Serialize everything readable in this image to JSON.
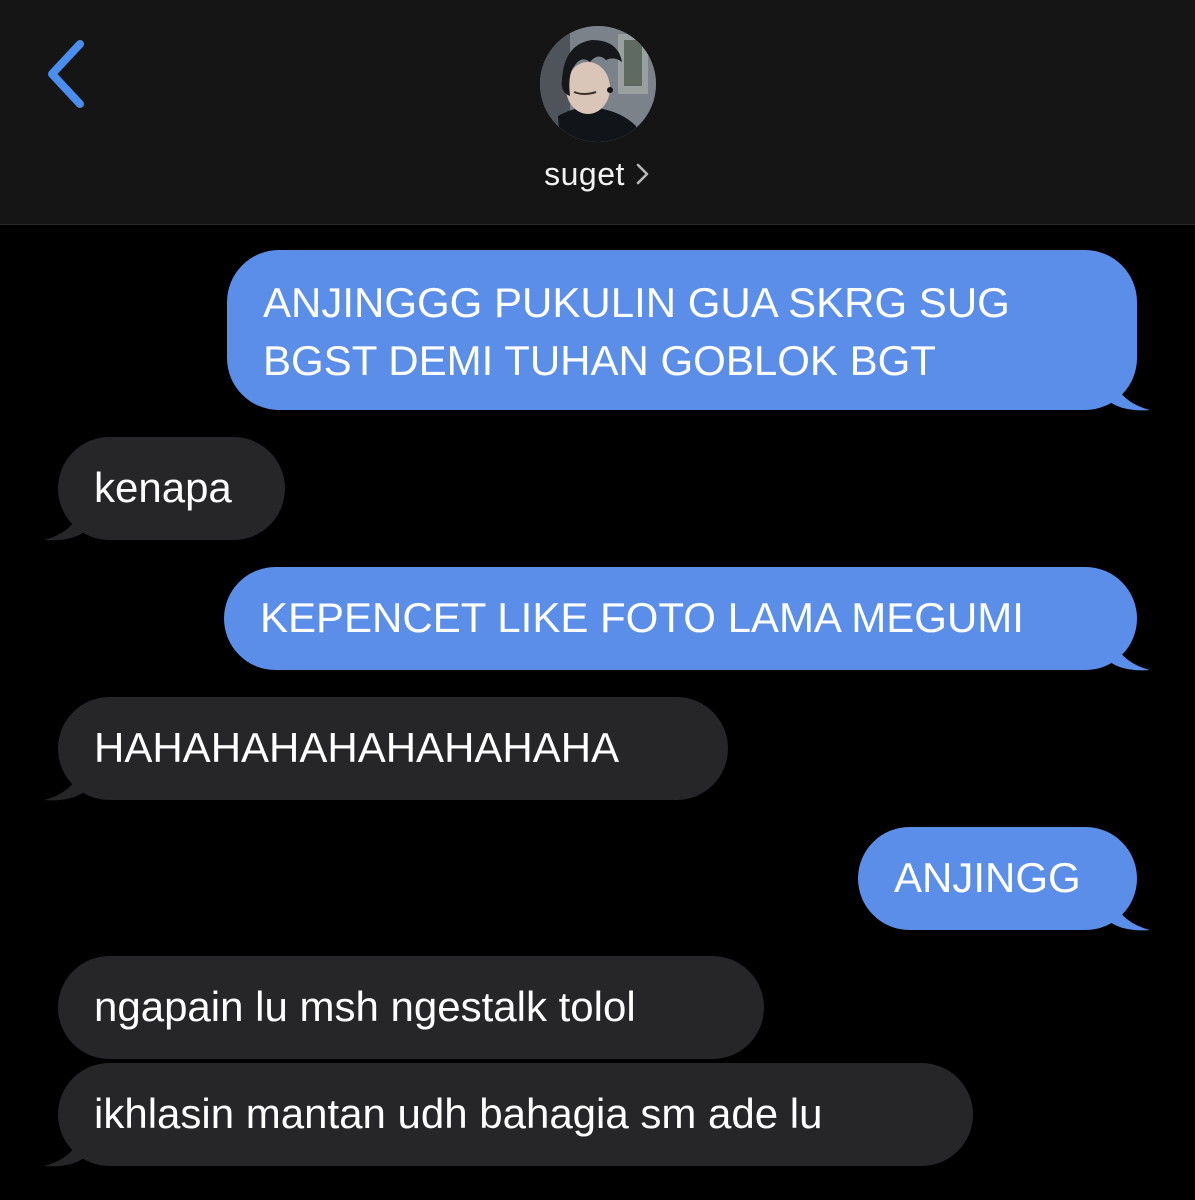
{
  "header": {
    "back_icon": "chevron-left-icon",
    "contact_name": "suget",
    "contact_chevron_icon": "chevron-right-icon",
    "accent_color": "#4a8ef0",
    "background_color": "#151515"
  },
  "messages": [
    {
      "direction": "outgoing",
      "text": "ANJINGGG PUKULIN GUA SKRG SUG",
      "text2": "BGST DEMI TUHAN GOBLOK BGT"
    },
    {
      "direction": "incoming",
      "text": "kenapa"
    },
    {
      "direction": "outgoing",
      "text": "KEPENCET LIKE FOTO LAMA MEGUMI"
    },
    {
      "direction": "incoming",
      "text": "HAHAHAHAHAHAHAHAHA"
    },
    {
      "direction": "outgoing",
      "text": "ANJINGG"
    },
    {
      "direction": "incoming",
      "text": "ngapain lu msh ngestalk tolol"
    },
    {
      "direction": "incoming",
      "text": "ikhlasin mantan udh bahagia sm ade lu"
    }
  ],
  "colors": {
    "outgoing_bubble": "#5b8ee8",
    "incoming_bubble": "#262629",
    "chat_background": "#000000"
  }
}
